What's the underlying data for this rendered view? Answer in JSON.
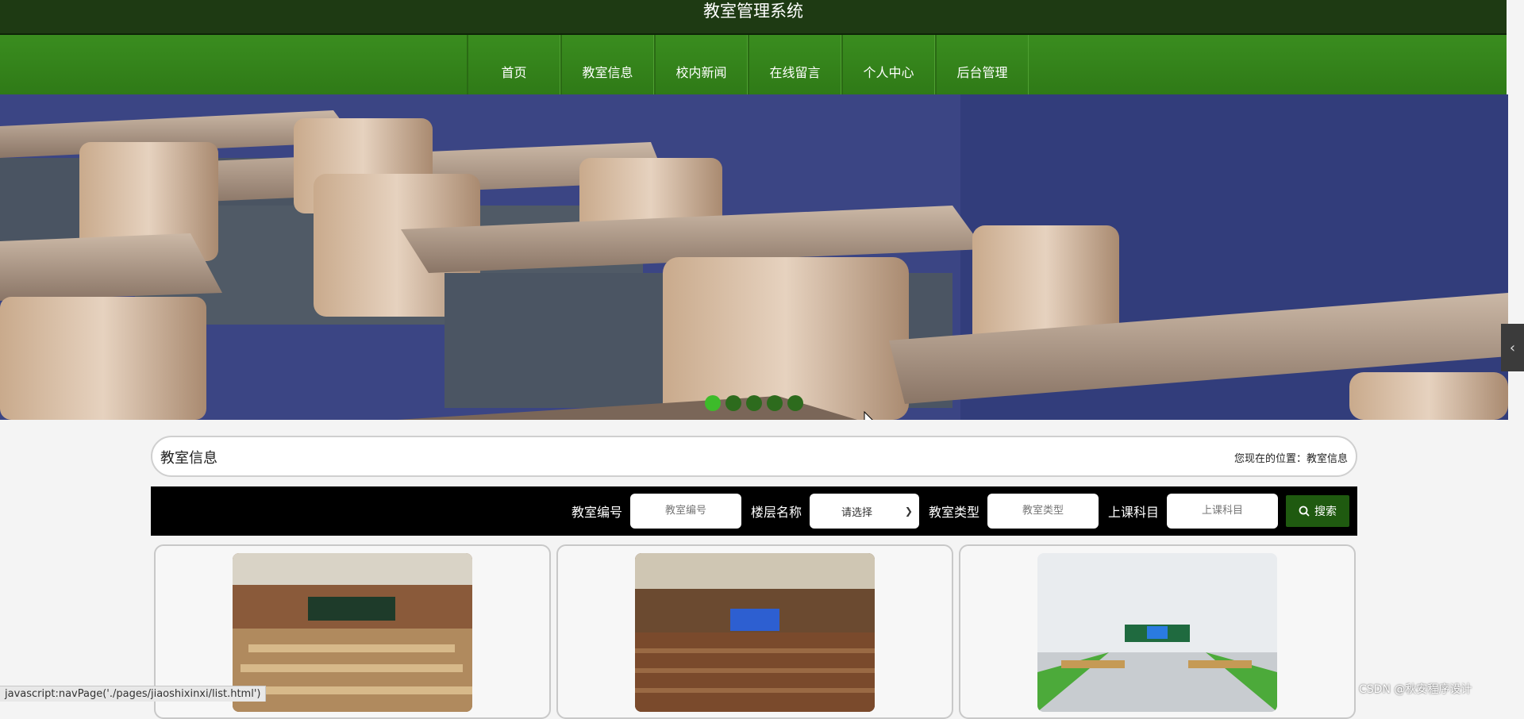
{
  "site": {
    "title": "教室管理系统"
  },
  "nav": {
    "items": [
      "首页",
      "教室信息",
      "校内新闻",
      "在线留言",
      "个人中心",
      "后台管理"
    ]
  },
  "banner": {
    "slides": 5,
    "active": 0
  },
  "section": {
    "title": "教室信息",
    "breadcrumb": "您现在的位置：教室信息"
  },
  "search": {
    "room_no_label": "教室编号",
    "room_no_placeholder": "教室编号",
    "floor_label": "楼层名称",
    "floor_selected": "请选择",
    "type_label": "教室类型",
    "type_placeholder": "教室类型",
    "subject_label": "上课科目",
    "subject_placeholder": "上课科目",
    "button_label": "搜索"
  },
  "statusbar": {
    "text": "javascript:navPage('./pages/jiaoshixinxi/list.html')"
  },
  "watermark": {
    "text": "CSDN @秋安程序设计"
  },
  "colors": {
    "titlebar": "#1e3a13",
    "navbar": "#3a8d1f",
    "accent": "#3dbb2a",
    "search_button": "#1f5a10"
  }
}
